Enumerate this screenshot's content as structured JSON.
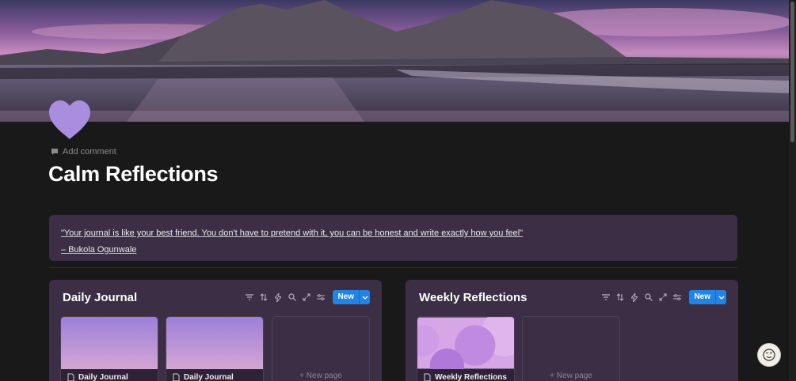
{
  "page": {
    "title": "Calm Reflections",
    "add_comment": "Add comment",
    "icon": "purple-heart-icon",
    "cover": "mountain-beach-sunset-cover"
  },
  "quote": {
    "text": "\"Your journal is like your best friend. You don't have to pretend with it, you can be honest and write exactly how you feel\"",
    "author": "– Bukola Ogunwale"
  },
  "databases": [
    {
      "title": "Daily Journal",
      "new_label": "New",
      "cards": [
        {
          "title": "Daily Journal"
        },
        {
          "title": "Daily Journal"
        }
      ],
      "new_page_label": "New page"
    },
    {
      "title": "Weekly Reflections",
      "new_label": "New",
      "cards": [
        {
          "title": "Weekly Reflections"
        }
      ],
      "new_page_label": "New page"
    }
  ],
  "colors": {
    "background": "#191919",
    "callout": "#3b2e45",
    "accent_blue": "#2383e2",
    "heart": "#a98ee0"
  }
}
